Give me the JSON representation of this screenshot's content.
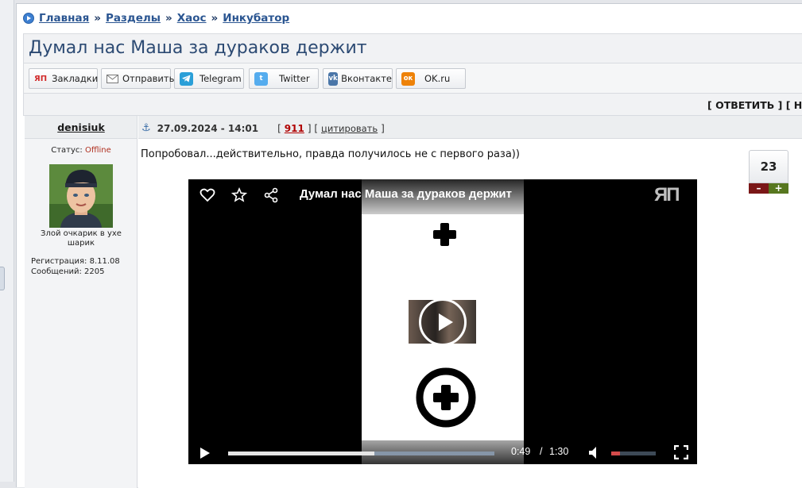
{
  "breadcrumb": {
    "items": [
      "Главная",
      "Разделы",
      "Хаос",
      "Инкубатор"
    ],
    "separator": "»"
  },
  "topic": {
    "title": "Думал нас Маша за дураков держит"
  },
  "share_buttons": [
    {
      "label": "Закладки",
      "icon": "yap-bookmark-icon",
      "color": "#d22b2b"
    },
    {
      "label": "Отправить",
      "icon": "mail-icon",
      "color": "#888888"
    },
    {
      "label": "Telegram",
      "icon": "telegram-icon",
      "color": "#2a9fd8"
    },
    {
      "label": "Twitter",
      "icon": "twitter-icon",
      "color": "#55acee"
    },
    {
      "label": "Вконтакте",
      "icon": "vk-icon",
      "color": "#4a76a8"
    },
    {
      "label": "OK.ru",
      "icon": "ok-icon",
      "color": "#ee8208"
    }
  ],
  "actions": {
    "reply_label": "[ ОТВЕТИТЬ ] [ НО"
  },
  "post": {
    "author": "denisiuk",
    "date": "27.09.2024 - 14:01",
    "post_number": "911",
    "quote_label": "цитировать",
    "status_label": "Статус:",
    "status_value": "Offline",
    "status_color": "#b03020",
    "nickname_line1": "Злой очкарик в ухе",
    "nickname_line2": "шарик",
    "registration": "Регистрация: 8.11.08",
    "messages": "Сообщений: 2205",
    "text": "Попробовал...действительно, правда получилось не с первого раза))",
    "rating": "23",
    "rate_minus": "–",
    "rate_plus": "+"
  },
  "video": {
    "title": "Думал нас Маша за дураков держит",
    "logo": "ЯП",
    "current_time": "0:49",
    "duration": "1:30",
    "time_separator": "/",
    "progress": 0.549,
    "volume": 0.2
  },
  "colors": {
    "link": "#2a5591",
    "title": "#2c4a73",
    "post_number": "#b00000"
  }
}
